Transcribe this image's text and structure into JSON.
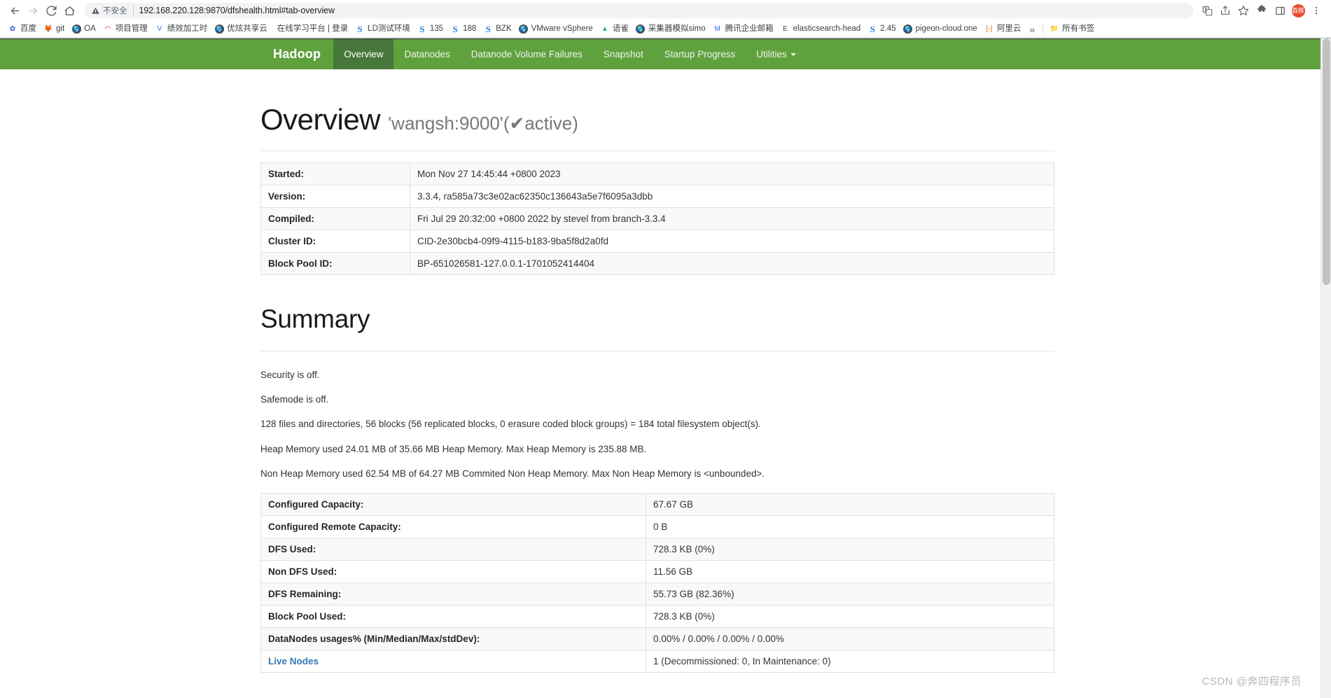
{
  "browser": {
    "back_icon": "back-arrow-icon",
    "forward_icon": "forward-arrow-icon",
    "reload_icon": "reload-icon",
    "home_icon": "home-icon",
    "security_label": "不安全",
    "url": "192.168.220.128:9870/dfshealth.html#tab-overview",
    "right_icons": [
      "translate-icon",
      "share-icon",
      "bookmark-star-icon",
      "extensions-puzzle-icon",
      "side-panel-icon",
      "profile-avatar",
      "chrome-menu-icon"
    ],
    "avatar_label": "森辉",
    "bookmarks": [
      {
        "label": "百度",
        "icon": "baidu-icon",
        "icon_char": "✿",
        "color": "#2b5fd9",
        "bg": "transparent"
      },
      {
        "label": "git",
        "icon": "gitlab-icon",
        "icon_char": "🦊",
        "color": "#e8702a",
        "bg": "transparent"
      },
      {
        "label": "OA",
        "icon": "globe-icon",
        "icon_char": "",
        "color": "#ffffff",
        "bg": "#4a4a4a"
      },
      {
        "label": "项目管理",
        "icon": "redmine-icon",
        "icon_char": "◠",
        "color": "#b81e1e",
        "bg": "transparent"
      },
      {
        "label": "绩效加工时",
        "icon": "v-icon",
        "icon_char": "V",
        "color": "#2d6ff0",
        "bg": "transparent"
      },
      {
        "label": "优炫共享云",
        "icon": "globe-icon",
        "icon_char": "",
        "color": "#ffffff",
        "bg": "#4a4a4a"
      },
      {
        "label": "在线学习平台 | 登录",
        "icon": "none-icon",
        "icon_char": "",
        "color": "#3c4043",
        "bg": "transparent"
      },
      {
        "label": "LD测试环境",
        "icon": "sogou-s-icon",
        "icon_char": "S",
        "color": "#2f7fe8",
        "bg": "transparent"
      },
      {
        "label": "135",
        "icon": "sogou-s-icon",
        "icon_char": "S",
        "color": "#2f7fe8",
        "bg": "transparent"
      },
      {
        "label": "188",
        "icon": "sogou-s-icon",
        "icon_char": "S",
        "color": "#2f7fe8",
        "bg": "transparent"
      },
      {
        "label": "BZK",
        "icon": "sogou-s-icon",
        "icon_char": "S",
        "color": "#2f7fe8",
        "bg": "transparent"
      },
      {
        "label": "VMware vSphere",
        "icon": "globe-icon",
        "icon_char": "",
        "color": "#ffffff",
        "bg": "#4a4a4a"
      },
      {
        "label": "语雀",
        "icon": "yuque-icon",
        "icon_char": "▲",
        "color": "#25b864",
        "bg": "transparent"
      },
      {
        "label": "采集器模拟simo",
        "icon": "globe-icon",
        "icon_char": "",
        "color": "#ffffff",
        "bg": "#4a4a4a"
      },
      {
        "label": "腾讯企业邮箱",
        "icon": "tencent-mail-icon",
        "icon_char": "M",
        "color": "#2d6ff0",
        "bg": "transparent"
      },
      {
        "label": "elasticsearch-head",
        "icon": "elasticsearch-icon",
        "icon_char": "E",
        "color": "#3a3a3a",
        "bg": "transparent"
      },
      {
        "label": "2.45",
        "icon": "sogou-s-icon",
        "icon_char": "S",
        "color": "#2f7fe8",
        "bg": "transparent"
      },
      {
        "label": "pigeon-cloud.one",
        "icon": "globe-icon",
        "icon_char": "",
        "color": "#ffffff",
        "bg": "#4a4a4a"
      },
      {
        "label": "阿里云",
        "icon": "aliyun-icon",
        "icon_char": "[-]",
        "color": "#ff6a00",
        "bg": "transparent"
      }
    ],
    "overflow_label": "»",
    "all_bookmarks_label": "所有书签",
    "all_bookmarks_icon": "folder-icon"
  },
  "navbar": {
    "brand": "Hadoop",
    "items": [
      {
        "label": "Overview",
        "active": true
      },
      {
        "label": "Datanodes",
        "active": false
      },
      {
        "label": "Datanode Volume Failures",
        "active": false
      },
      {
        "label": "Snapshot",
        "active": false
      },
      {
        "label": "Startup Progress",
        "active": false
      },
      {
        "label": "Utilities",
        "active": false,
        "dropdown": true
      }
    ]
  },
  "overview": {
    "title": "Overview",
    "host": "'wangsh:9000'",
    "state_open": "(",
    "state_check": "✔",
    "state_label": "active",
    "state_close": ")",
    "rows": [
      {
        "key": "Started:",
        "value": "Mon Nov 27 14:45:44 +0800 2023"
      },
      {
        "key": "Version:",
        "value": "3.3.4, ra585a73c3e02ac62350c136643a5e7f6095a3dbb"
      },
      {
        "key": "Compiled:",
        "value": "Fri Jul 29 20:32:00 +0800 2022 by stevel from branch-3.3.4"
      },
      {
        "key": "Cluster ID:",
        "value": "CID-2e30bcb4-09f9-4115-b183-9ba5f8d2a0fd"
      },
      {
        "key": "Block Pool ID:",
        "value": "BP-651026581-127.0.0.1-1701052414404"
      }
    ]
  },
  "summary": {
    "title": "Summary",
    "notes": [
      "Security is off.",
      "Safemode is off.",
      "128 files and directories, 56 blocks (56 replicated blocks, 0 erasure coded block groups) = 184 total filesystem object(s).",
      "Heap Memory used 24.01 MB of 35.66 MB Heap Memory. Max Heap Memory is 235.88 MB.",
      "Non Heap Memory used 62.54 MB of 64.27 MB Commited Non Heap Memory. Max Non Heap Memory is <unbounded>."
    ],
    "rows": [
      {
        "key": "Configured Capacity:",
        "value": "67.67 GB",
        "link": false
      },
      {
        "key": "Configured Remote Capacity:",
        "value": "0 B",
        "link": false
      },
      {
        "key": "DFS Used:",
        "value": "728.3 KB (0%)",
        "link": false
      },
      {
        "key": "Non DFS Used:",
        "value": "11.56 GB",
        "link": false
      },
      {
        "key": "DFS Remaining:",
        "value": "55.73 GB (82.36%)",
        "link": false
      },
      {
        "key": "Block Pool Used:",
        "value": "728.3 KB (0%)",
        "link": false
      },
      {
        "key": "DataNodes usages% (Min/Median/Max/stdDev):",
        "value": "0.00% / 0.00% / 0.00% / 0.00%",
        "link": false
      },
      {
        "key": "Live Nodes",
        "value": "1 (Decommissioned: 0, In Maintenance: 0)",
        "link": true
      }
    ]
  },
  "watermark": "CSDN @奔四程序员",
  "colors": {
    "navbar_green": "#5fa23d",
    "navbar_active_green": "#47773a",
    "link_blue": "#337ab7",
    "check_green": "#5cb85c"
  }
}
